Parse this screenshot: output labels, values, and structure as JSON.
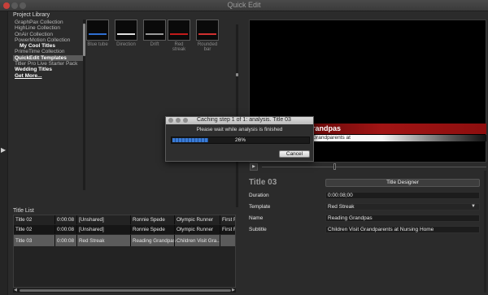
{
  "window": {
    "title": "Quick Edit",
    "traffic_lights": [
      "#c8403a",
      "#5a5a5a",
      "#5a5a5a"
    ]
  },
  "project_library": {
    "title": "Project Library",
    "items": [
      {
        "label": "GraphPax Collection",
        "style": "normal"
      },
      {
        "label": "HighLine Collection",
        "style": "normal"
      },
      {
        "label": "OnAir Collection",
        "style": "normal"
      },
      {
        "label": "PowerMotion Collection",
        "style": "normal"
      },
      {
        "label": "My Cool Titles",
        "style": "sub"
      },
      {
        "label": "PrimeTime Collection",
        "style": "normal"
      },
      {
        "label": "QuickEdit Templates",
        "style": "selected"
      },
      {
        "label": "Titler Pro Live Starter Pack",
        "style": "normal"
      },
      {
        "label": "Wedding Titles",
        "style": "bold"
      },
      {
        "label": "Get More...",
        "style": "more"
      }
    ]
  },
  "templates": [
    {
      "label": "Blue tube",
      "strip": "#2f6fd1"
    },
    {
      "label": "Direction",
      "strip": "#e0e0e0"
    },
    {
      "label": "Drift",
      "strip": "#9a9a9a"
    },
    {
      "label": "Red streak",
      "strip": "#c21a1a"
    },
    {
      "label": "Rounded\nbar",
      "strip": "#d03030"
    }
  ],
  "preview": {
    "title_text": "randpas",
    "subtitle_text": "Grandparents at"
  },
  "inspector": {
    "title": "Title 03",
    "designer_button": "Title Designer",
    "fields": [
      {
        "label": "Duration",
        "value": "0:00:08;00",
        "type": "text"
      },
      {
        "label": "Template",
        "value": "Red Streak",
        "type": "select"
      },
      {
        "label": "Name",
        "value": "Reading Grandpas",
        "type": "text"
      },
      {
        "label": "Subtitle",
        "value": "Children Visit Grandparents at Nursing Home",
        "type": "text"
      }
    ]
  },
  "title_list": {
    "label": "Title List",
    "rows": [
      {
        "name": "Title 02",
        "duration": "0:00:08",
        "template": "[Unshared]",
        "c4": "Ronnie Spede",
        "c5": "Olympic Runner",
        "c6": "First F",
        "state": "normal"
      },
      {
        "name": "Title 02",
        "duration": "0:00:08",
        "template": "[Unshared]",
        "c4": "Ronnie Spede",
        "c5": "Olympic Runner",
        "c6": "First F",
        "state": "alt"
      },
      {
        "name": "Title 03",
        "duration": "0:00:08",
        "template": "Red Streak",
        "c4": "Reading Grandpas",
        "c5": "Children Visit Gra...",
        "c6": "",
        "state": "selected"
      }
    ]
  },
  "dialog": {
    "title": "Caching step 1 of 1: analysis. Title 03",
    "message": "Please wait while analysis is finished",
    "progress_percent": 26,
    "progress_label": "26%",
    "cancel_label": "Cancel"
  }
}
